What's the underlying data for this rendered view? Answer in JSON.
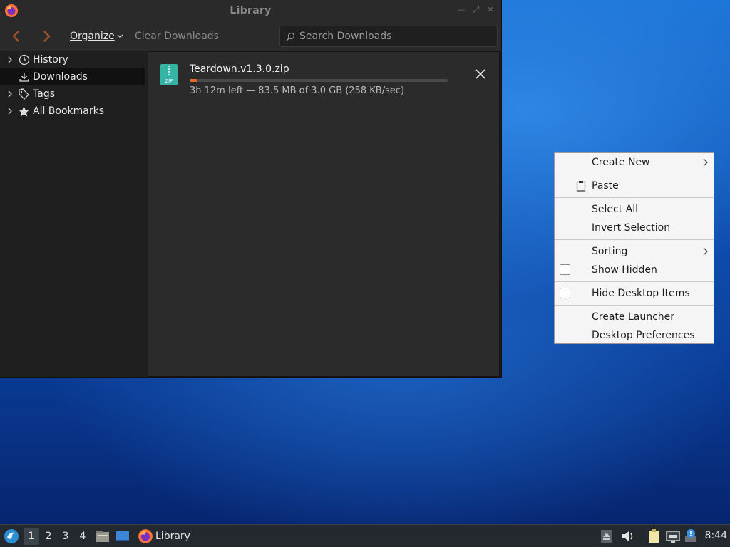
{
  "library": {
    "title": "Library",
    "toolbar": {
      "organize_label": "Organize",
      "clear_label": "Clear Downloads",
      "search_placeholder": "Search Downloads"
    },
    "sidebar": {
      "items": [
        {
          "label": "History",
          "icon": "clock-icon",
          "expandable": true,
          "selected": false
        },
        {
          "label": "Downloads",
          "icon": "download-icon",
          "expandable": false,
          "selected": true
        },
        {
          "label": "Tags",
          "icon": "tags-icon",
          "expandable": true,
          "selected": false
        },
        {
          "label": "All Bookmarks",
          "icon": "star-icon",
          "expandable": true,
          "selected": false
        }
      ]
    },
    "downloads": [
      {
        "filename": "Teardown.v1.3.0.zip",
        "status": "3h 12m left — 83.5 MB of 3.0 GB (258 KB/sec)",
        "progress": 0.027,
        "icon": "zip-icon"
      }
    ]
  },
  "context_menu": {
    "items": [
      {
        "label": "Create New",
        "submenu": true
      },
      {
        "label": "Paste",
        "icon": "clipboard-icon"
      },
      {
        "label": "Select All"
      },
      {
        "label": "Invert Selection"
      },
      {
        "label": "Sorting",
        "submenu": true
      },
      {
        "label": "Show Hidden",
        "checkbox": true,
        "checked": false
      },
      {
        "label": "Hide Desktop Items",
        "checkbox": true,
        "checked": false
      },
      {
        "label": "Create Launcher"
      },
      {
        "label": "Desktop Preferences"
      }
    ]
  },
  "taskbar": {
    "workspaces": [
      "1",
      "2",
      "3",
      "4"
    ],
    "active_workspace": "1",
    "task_label": "Library",
    "clock": "8:44"
  },
  "colors": {
    "progress_fill": "#e2692a",
    "window_bg": "#1f1f1f",
    "menu_bg": "#f5f5f5",
    "taskbar_bg": "#23292f"
  }
}
